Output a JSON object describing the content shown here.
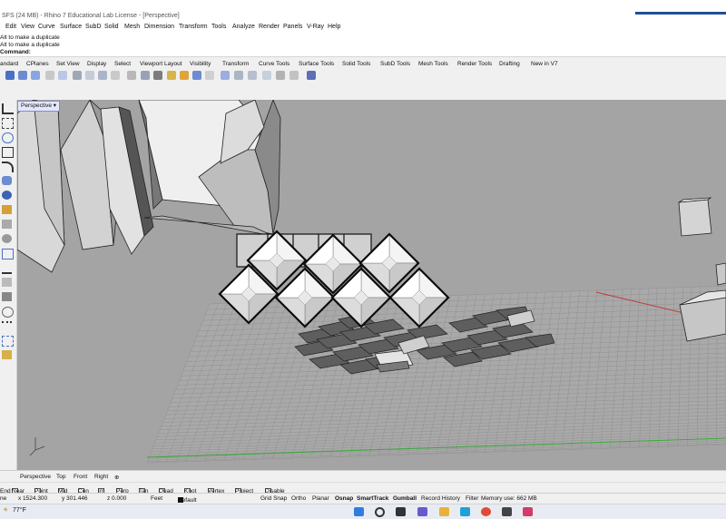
{
  "window": {
    "title": "SFS (24 MB) - Rhino 7 Educational Lab License - [Perspective]"
  },
  "menu": [
    "Edit",
    "View",
    "Curve",
    "Surface",
    "SubD",
    "Solid",
    "Mesh",
    "Dimension",
    "Transform",
    "Tools",
    "Analyze",
    "Render",
    "Panels",
    "V-Ray",
    "Help"
  ],
  "command_history": [
    "Alt to make a duplicate",
    "Alt to make a duplicate"
  ],
  "command_prompt": "Command:",
  "toolbar_tabs": [
    "andard",
    "CPlanes",
    "Set View",
    "Display",
    "Select",
    "Viewport Layout",
    "Visibility",
    "Transform",
    "Curve Tools",
    "Surface Tools",
    "Solid Tools",
    "SubD Tools",
    "Mesh Tools",
    "Render Tools",
    "Drafting",
    "New in V7"
  ],
  "viewport": {
    "label": "Perspective",
    "menu_glyph": "▾"
  },
  "viewport_tabs": [
    "Perspective",
    "Top",
    "Front",
    "Right"
  ],
  "viewport_tabs_add": "⊕",
  "osnaps": [
    "End",
    "Near",
    "Point",
    "Mid",
    "Cen",
    "Int",
    "Perp",
    "Tan",
    "Quad",
    "Knot",
    "Vertex",
    "Project",
    "Disable"
  ],
  "status": {
    "plane": "ne",
    "x": "x 1524.300",
    "y": "y 301.446",
    "z": "z 0.000",
    "units": "Feet",
    "layer": "Default",
    "toggles": [
      "Grid Snap",
      "Ortho",
      "Planar",
      "Osnap",
      "SmartTrack",
      "Gumball",
      "Record History",
      "Filter"
    ],
    "memory": "Memory use: 662 MB"
  },
  "taskbar": {
    "weather": "77°F"
  },
  "colors": {
    "viewport_bg": "#a4a4a4",
    "grid_line": "#8c8c8c",
    "x_axis": "#c43a3a",
    "y_axis": "#3aa83a",
    "active_tab_border": "#7d8ed8"
  }
}
